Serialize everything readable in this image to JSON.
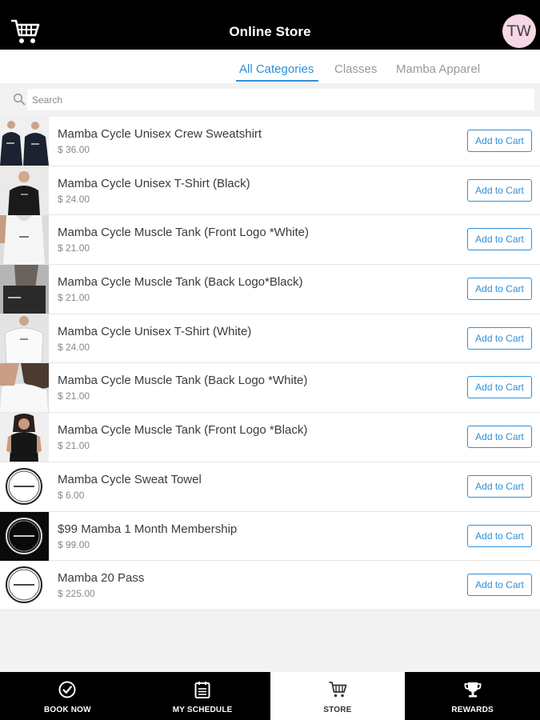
{
  "header": {
    "title": "Online Store",
    "avatar_initials": "TW",
    "cart_icon": "cart-icon"
  },
  "tabs": [
    {
      "label": "All Categories",
      "active": true
    },
    {
      "label": "Classes",
      "active": false
    },
    {
      "label": "Mamba Apparel",
      "active": false
    }
  ],
  "search": {
    "placeholder": "Search",
    "value": ""
  },
  "products": [
    {
      "name": "Mamba Cycle Unisex Crew Sweatshirt",
      "price": "$ 36.00",
      "button": "Add to Cart",
      "thumb": "two-people-dark-sweatshirts"
    },
    {
      "name": "Mamba Cycle Unisex T-Shirt (Black)",
      "price": "$ 24.00",
      "button": "Add to Cart",
      "thumb": "man-black-tshirt"
    },
    {
      "name": "Mamba Cycle Muscle Tank (Front Logo *White)",
      "price": "$ 21.00",
      "button": "Add to Cart",
      "thumb": "white-tank-front"
    },
    {
      "name": "Mamba Cycle Muscle Tank (Back Logo*Black)",
      "price": "$ 21.00",
      "button": "Add to Cart",
      "thumb": "black-tank-back"
    },
    {
      "name": "Mamba Cycle Unisex T-Shirt (White)",
      "price": "$ 24.00",
      "button": "Add to Cart",
      "thumb": "white-tshirt"
    },
    {
      "name": "Mamba Cycle Muscle Tank (Back Logo *White)",
      "price": "$ 21.00",
      "button": "Add to Cart",
      "thumb": "white-tank-back"
    },
    {
      "name": "Mamba Cycle Muscle Tank (Front Logo *Black)",
      "price": "$ 21.00",
      "button": "Add to Cart",
      "thumb": "woman-black-tank"
    },
    {
      "name": "Mamba Cycle Sweat Towel",
      "price": "$ 6.00",
      "button": "Add to Cart",
      "thumb": "logo-circle-white"
    },
    {
      "name": "$99 Mamba 1 Month Membership",
      "price": "$ 99.00",
      "button": "Add to Cart",
      "thumb": "logo-circle-black"
    },
    {
      "name": "Mamba 20 Pass",
      "price": "$ 225.00",
      "button": "Add to Cart",
      "thumb": "logo-circle-white"
    }
  ],
  "bottom_nav": [
    {
      "label": "BOOK NOW",
      "icon": "check-circle-icon",
      "active": false
    },
    {
      "label": "MY SCHEDULE",
      "icon": "calendar-icon",
      "active": false
    },
    {
      "label": "STORE",
      "icon": "cart-icon",
      "active": true
    },
    {
      "label": "REWARDS",
      "icon": "trophy-icon",
      "active": false
    }
  ],
  "colors": {
    "accent": "#2e8fd8",
    "header_bg": "#000000",
    "avatar_bg": "#f7d6e6",
    "page_bg": "#f2f2f2"
  }
}
